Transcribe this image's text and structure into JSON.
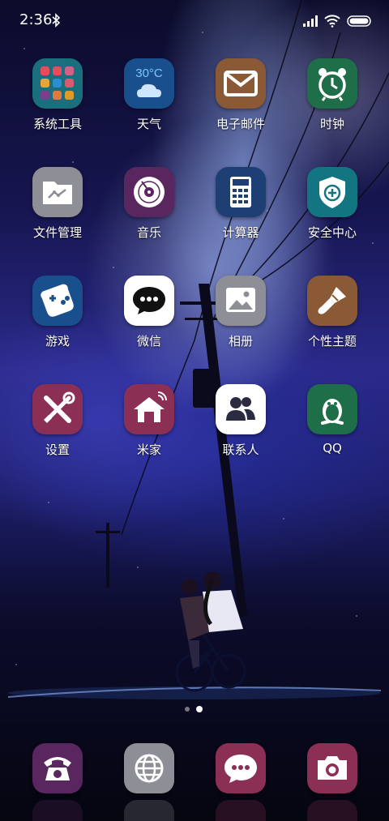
{
  "status_bar": {
    "time": "2:36",
    "icons": [
      "bluetooth-icon",
      "signal-icon",
      "wifi-icon",
      "battery-icon"
    ]
  },
  "apps": [
    {
      "label": "系统工具",
      "icon": "system-tools-folder-icon",
      "color": "#1a6f7e"
    },
    {
      "label": "天气",
      "icon": "weather-icon",
      "color": "#1a4f8e",
      "icon_text": "30°C"
    },
    {
      "label": "电子邮件",
      "icon": "mail-icon",
      "color": "#8a5a36"
    },
    {
      "label": "时钟",
      "icon": "clock-icon",
      "color": "#1e6e49"
    },
    {
      "label": "文件管理",
      "icon": "file-manager-icon",
      "color": "#8e8e96"
    },
    {
      "label": "音乐",
      "icon": "music-disc-icon",
      "color": "#5a2660"
    },
    {
      "label": "计算器",
      "icon": "calculator-icon",
      "color": "#1d3f73"
    },
    {
      "label": "安全中心",
      "icon": "security-shield-icon",
      "color": "#137581"
    },
    {
      "label": "游戏",
      "icon": "gamepad-icon",
      "color": "#1a4f8e"
    },
    {
      "label": "微信",
      "icon": "wechat-icon",
      "color": "#ffffff"
    },
    {
      "label": "相册",
      "icon": "gallery-icon",
      "color": "#8e8e96"
    },
    {
      "label": "个性主题",
      "icon": "theme-brush-icon",
      "color": "#8a5a36"
    },
    {
      "label": "设置",
      "icon": "settings-tools-icon",
      "color": "#8c2f55"
    },
    {
      "label": "米家",
      "icon": "mijia-home-icon",
      "color": "#8c2f55"
    },
    {
      "label": "联系人",
      "icon": "contacts-icon",
      "color": "#ffffff"
    },
    {
      "label": "QQ",
      "icon": "qq-penguin-icon",
      "color": "#1e6e49"
    }
  ],
  "pager": {
    "pages": 2,
    "active": 2
  },
  "dock": [
    {
      "icon": "phone-icon",
      "color": "#5a2660"
    },
    {
      "icon": "browser-globe-icon",
      "color": "#8e8e96"
    },
    {
      "icon": "messages-icon",
      "color": "#8c2f55"
    },
    {
      "icon": "camera-icon",
      "color": "#8c2f55"
    }
  ]
}
